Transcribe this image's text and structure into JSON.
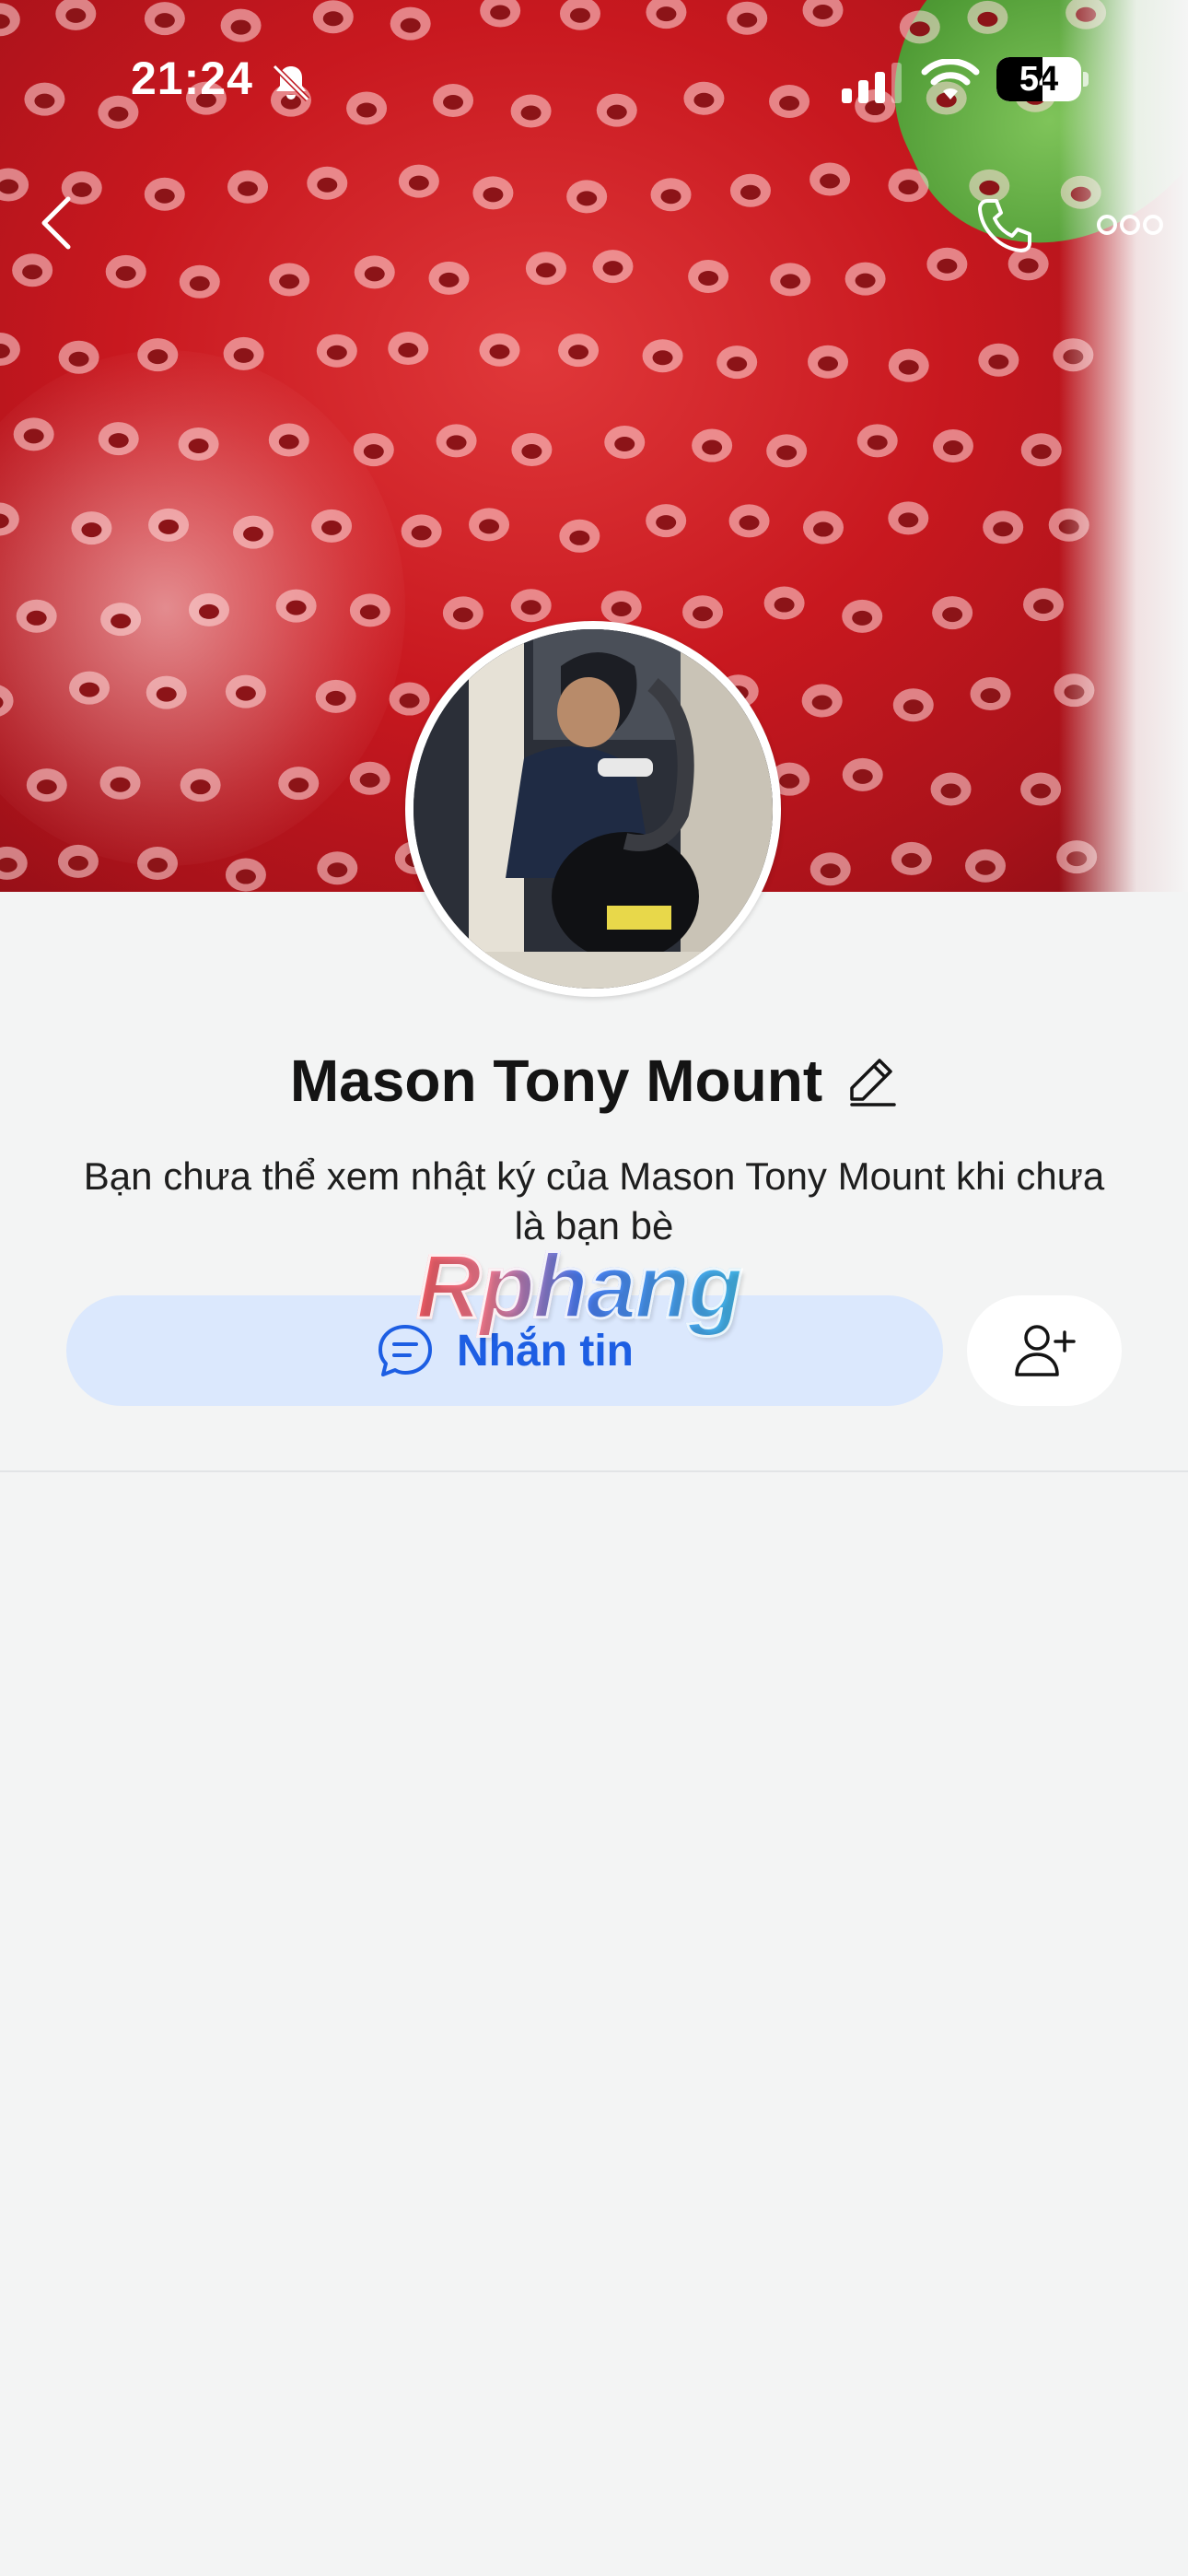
{
  "status_bar": {
    "time": "21:24",
    "battery_level": "54",
    "battery_fraction": 0.54
  },
  "profile": {
    "name": "Mason Tony Mount",
    "privacy_message": "Bạn chưa thể xem nhật ký của Mason Tony Mount khi chưa là bạn bè"
  },
  "actions": {
    "message_label": "Nhắn tin"
  },
  "watermark": "Rphang",
  "icons": {
    "back": "chevron-left-icon",
    "call": "phone-icon",
    "more": "more-horizontal-icon",
    "edit": "pencil-icon",
    "message": "chat-bubble-icon",
    "add_friend": "user-plus-icon",
    "mute": "bell-off-icon"
  },
  "colors": {
    "accent": "#1d5ee3",
    "message_button_bg": "#dbe8fd",
    "page_bg": "#f3f4f4"
  }
}
